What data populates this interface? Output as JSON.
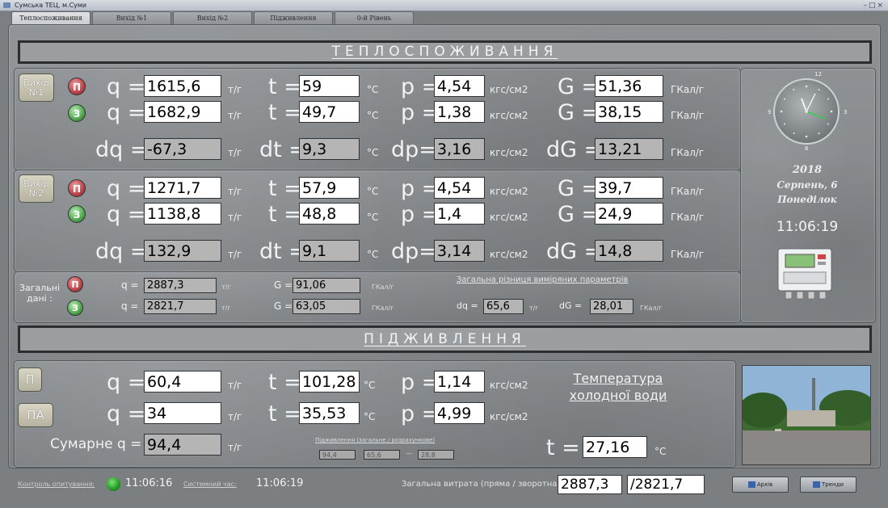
{
  "window": {
    "title": "Сумська ТЕЦ, м.Суми"
  },
  "tabs": [
    "Теплоспоживання",
    "Вихід №1",
    "Вихід №2",
    "Підживлення",
    "0-й Рівень"
  ],
  "banners": {
    "heat": "ТЕПЛОСПОЖИВАННЯ",
    "feed": "ПІДЖИВЛЕННЯ"
  },
  "labels": {
    "q": "q =",
    "t": "t =",
    "p": "p =",
    "G": "G =",
    "dq": "dq =",
    "dt": "dt =",
    "dp": "dp=",
    "dG": "dG =",
    "P": "П",
    "Z": "З",
    "PA": "ПА"
  },
  "units": {
    "tph": "т/г",
    "degC": "°C",
    "kgf": "кгс/см2",
    "gcal": "ГКал/г"
  },
  "output1": {
    "button": "Вихід №1",
    "supply": {
      "q": "1615,6",
      "t": "59",
      "p": "4,54",
      "G": "51,36"
    },
    "return": {
      "q": "1682,9",
      "t": "49,7",
      "p": "1,38",
      "G": "38,15"
    },
    "diff": {
      "dq": "-67,3",
      "dt": "9,3",
      "dp": "3,16",
      "dG": "13,21"
    }
  },
  "output2": {
    "button": "Вихід №2",
    "supply": {
      "q": "1271,7",
      "t": "57,9",
      "p": "4,54",
      "G": "39,7"
    },
    "return": {
      "q": "1138,8",
      "t": "48,8",
      "p": "1,4",
      "G": "24,9"
    },
    "diff": {
      "dq": "132,9",
      "dt": "9,1",
      "dp": "3,14",
      "dG": "14,8"
    }
  },
  "totals": {
    "label": "Загальні дані :",
    "supply": {
      "q": "2887,3",
      "G": "91,06"
    },
    "return": {
      "q": "2821,7",
      "G": "63,05"
    },
    "diff_title": "Загальна різниця виміряних параметрів",
    "dq": "65,6",
    "dG": "28,01"
  },
  "clock": {
    "year": "2018",
    "date": "Серпень, 6",
    "weekday": "Понеділок",
    "time": "11:06:19"
  },
  "feed": {
    "P": {
      "q": "60,4",
      "t": "101,28",
      "p": "1,14"
    },
    "PA": {
      "q": "34",
      "t": "35,53",
      "p": "4,99"
    },
    "sum_label": "Сумарне q =",
    "sum": "94,4",
    "cold_water_title": "Температура холодної води",
    "cold_t": "27,16",
    "small_caption": "Підживлення (загальне / розрахункове)",
    "small_vals": [
      "94,4",
      "65,6",
      "28,8"
    ]
  },
  "status": {
    "control_label": "Контроль опитування:",
    "control_time": "11:06:16",
    "system_label": "Системний час:",
    "system_time": "11:06:19",
    "total_label": "Загальна витрата (пряма / зворотна)",
    "total_direct": "2887,3",
    "total_return": "/2821,7",
    "btn_archive": "Архів",
    "btn_trends": "Тренди"
  },
  "colors": {
    "led_red": "#b9444a",
    "led_green": "#4fa64e",
    "clock_hand": "#32d04a"
  }
}
